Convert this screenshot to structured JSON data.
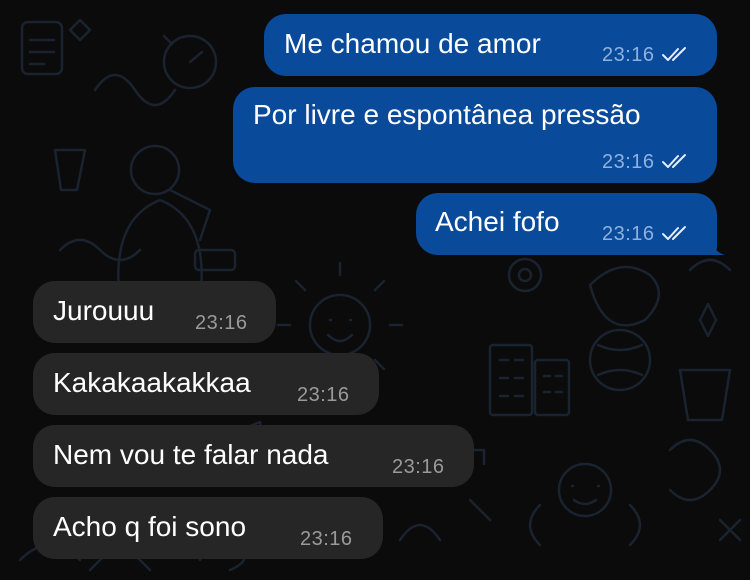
{
  "colors": {
    "background": "#0b0b0b",
    "outgoing_bubble": "#0a4a9a",
    "incoming_bubble": "#262626",
    "outgoing_time": "#8eb2dd",
    "incoming_time": "#9a9a9a",
    "read_ticks": "#e6eefb"
  },
  "messages": [
    {
      "direction": "outgoing",
      "text": "Me chamou de amor",
      "time": "23:16",
      "status_icon": "double-check-read-icon"
    },
    {
      "direction": "outgoing",
      "text": "Por livre e espontânea pressão",
      "time": "23:16",
      "status_icon": "double-check-read-icon"
    },
    {
      "direction": "outgoing",
      "text": "Achei fofo",
      "time": "23:16",
      "status_icon": "double-check-read-icon"
    },
    {
      "direction": "incoming",
      "text": "Jurouuu",
      "time": "23:16"
    },
    {
      "direction": "incoming",
      "text": "Kakakaakakkaa",
      "time": "23:16"
    },
    {
      "direction": "incoming",
      "text": "Nem vou te falar nada",
      "time": "23:16"
    },
    {
      "direction": "incoming",
      "text": "Acho q foi sono",
      "time": "23:16"
    }
  ]
}
